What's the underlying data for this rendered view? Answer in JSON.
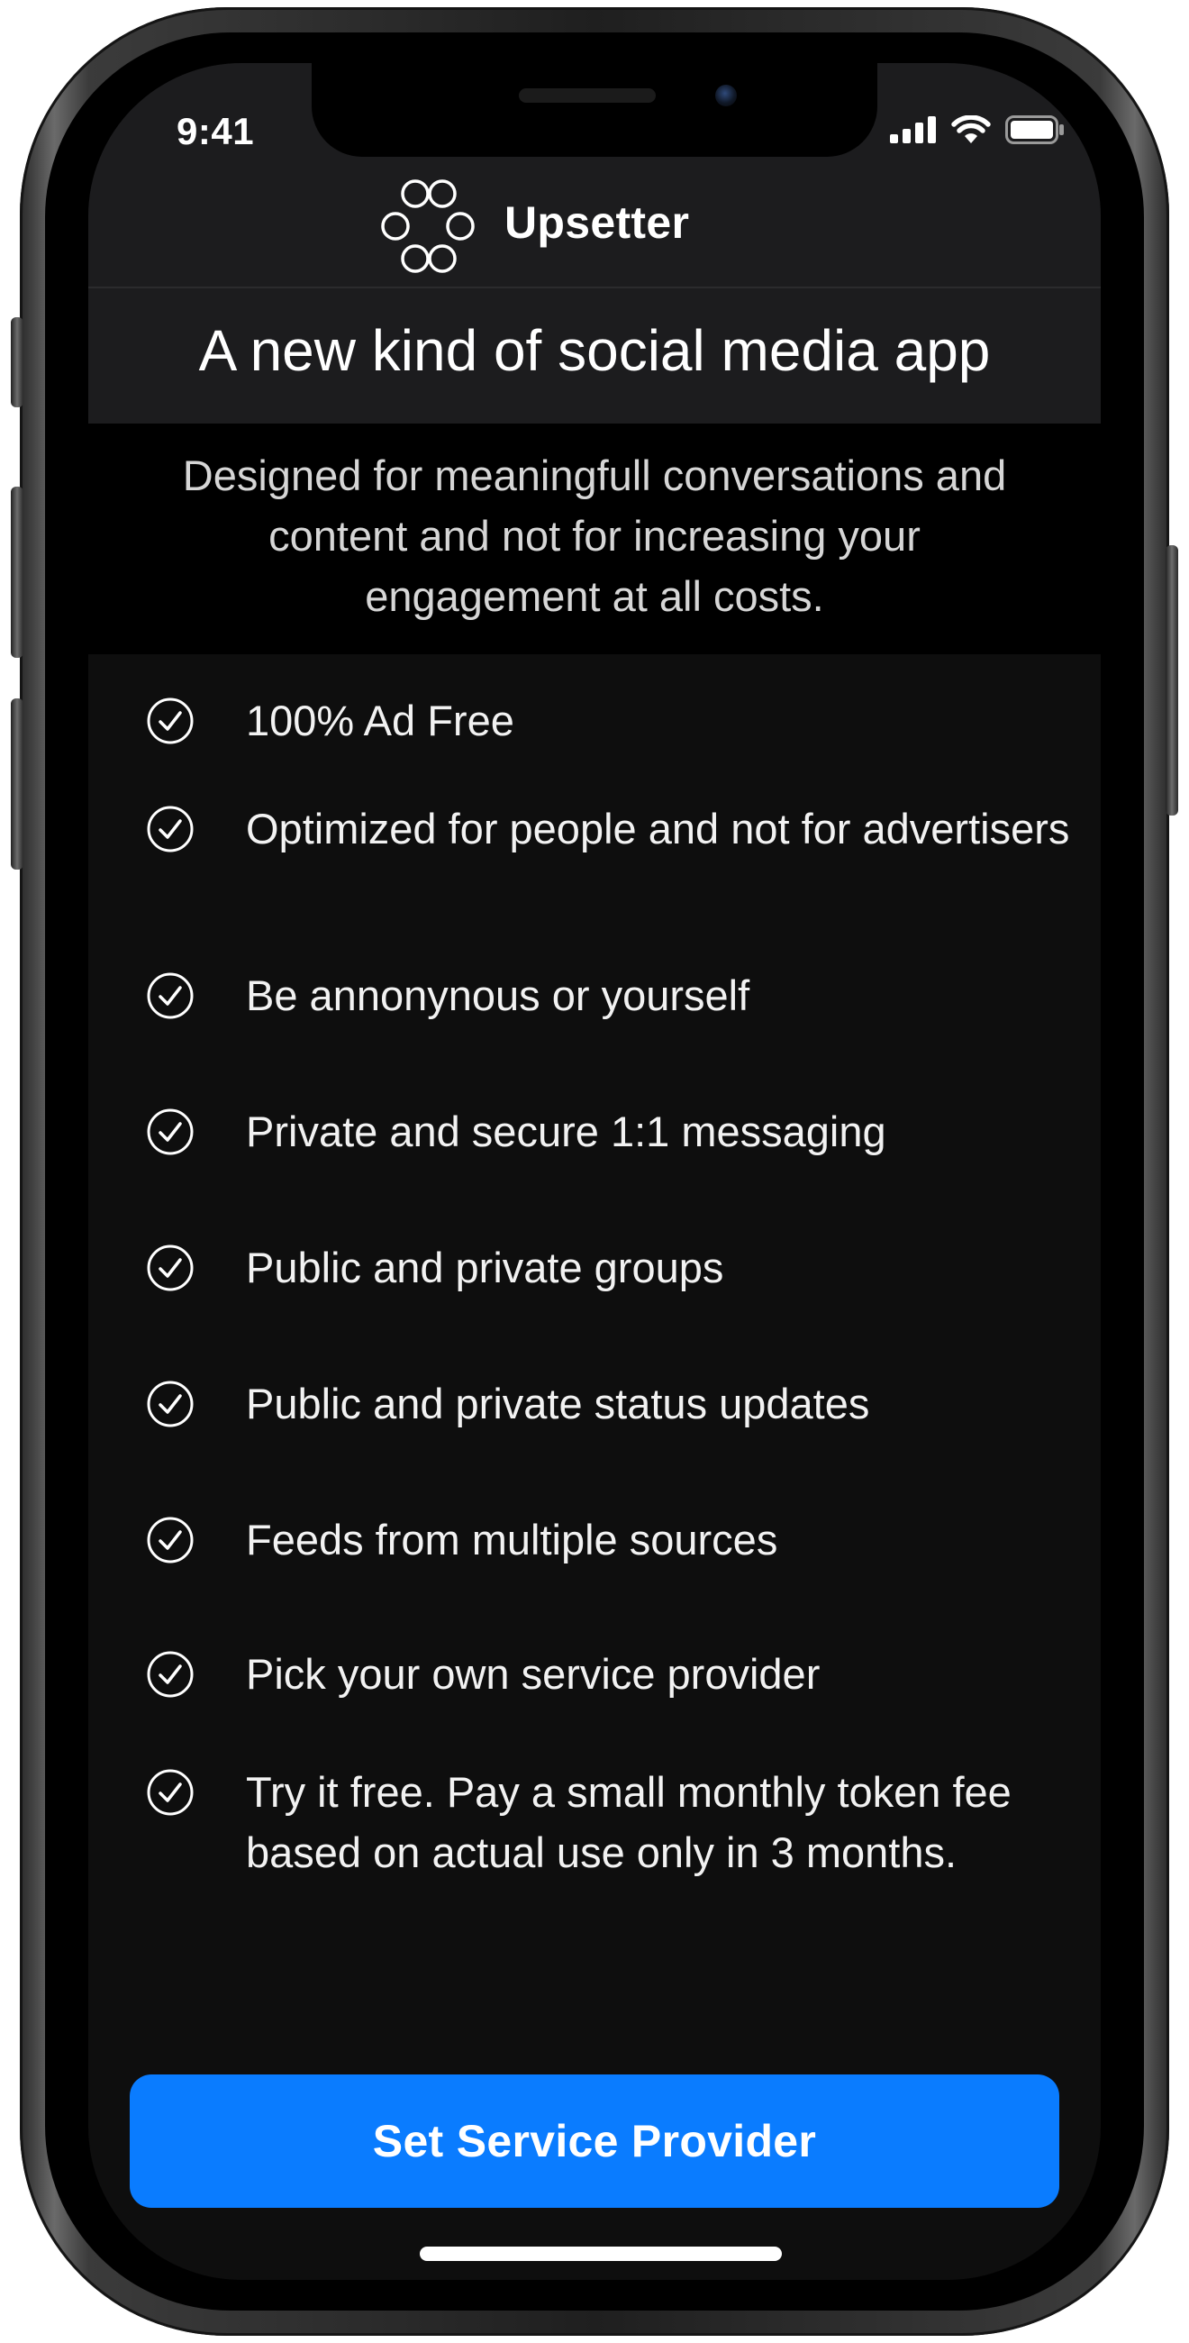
{
  "status_bar": {
    "time": "9:41",
    "icons": [
      "signal-icon",
      "wifi-icon",
      "battery-icon"
    ]
  },
  "header": {
    "app_name": "Upsetter",
    "logo_icon": "rings-logo-icon"
  },
  "intro": {
    "title": "A new kind of social media app",
    "subtitle": "Designed for meaningfull conversations and content and not for increasing your engagement at all costs."
  },
  "features": [
    {
      "icon": "check-circle-icon",
      "text": "100% Ad Free"
    },
    {
      "icon": "check-circle-icon",
      "text": "Optimized for people and not for advertisers"
    },
    {
      "icon": "check-circle-icon",
      "text": "Be annonynous or yourself"
    },
    {
      "icon": "check-circle-icon",
      "text": "Private and secure 1:1 messaging"
    },
    {
      "icon": "check-circle-icon",
      "text": "Public and private groups"
    },
    {
      "icon": "check-circle-icon",
      "text": "Public and private status updates"
    },
    {
      "icon": "check-circle-icon",
      "text": "Feeds from multiple sources"
    },
    {
      "icon": "check-circle-icon",
      "text": "Pick your own service provider"
    },
    {
      "icon": "check-circle-icon",
      "text": "Try it free. Pay a small monthly token fee based on actual use only in 3 months."
    }
  ],
  "cta": {
    "label": "Set Service Provider"
  },
  "colors": {
    "accent": "#0a7cff",
    "background": "#0e0e0e",
    "header_background": "#1c1c1e",
    "subtitle_background": "#000000"
  }
}
